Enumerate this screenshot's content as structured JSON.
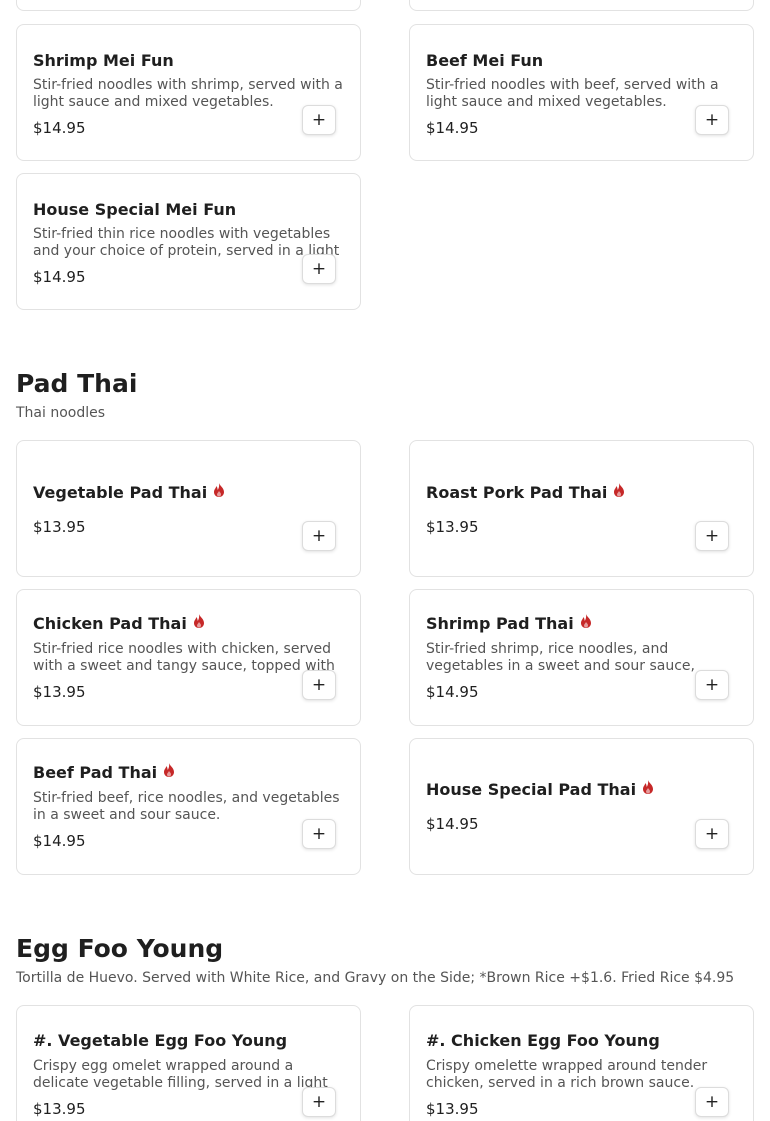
{
  "colors": {
    "flame": "#c62828",
    "border": "#e2e2e2",
    "desc": "#555555"
  },
  "mei_fun": {
    "items": [
      {
        "name": "Shrimp Mei Fun",
        "desc": "Stir-fried noodles with shrimp, served with a light sauce and mixed vegetables.",
        "price": "$14.95",
        "add": "+"
      },
      {
        "name": "Beef Mei Fun",
        "desc": "Stir-fried noodles with beef, served with a light sauce and mixed vegetables.",
        "price": "$14.95",
        "add": "+"
      },
      {
        "name": "House Special Mei Fun",
        "desc": "Stir-fried thin rice noodles with vegetables and your choice of protein, served in a light sauce.",
        "price": "$14.95",
        "add": "+"
      }
    ]
  },
  "pad_thai": {
    "title": "Pad Thai",
    "subtitle": "Thai noodles",
    "items": [
      {
        "name": "Vegetable Pad Thai",
        "icon": "spicy-flame-icon",
        "desc": "",
        "price": "$13.95",
        "add": "+"
      },
      {
        "name": "Roast Pork Pad Thai",
        "icon": "spicy-flame-icon",
        "desc": "",
        "price": "$13.95",
        "add": "+"
      },
      {
        "name": "Chicken Pad Thai",
        "icon": "spicy-flame-icon",
        "desc": "Stir-fried rice noodles with chicken, served with a sweet and tangy sauce, topped with peanuts.",
        "price": "$13.95",
        "add": "+"
      },
      {
        "name": "Shrimp Pad Thai",
        "icon": "spicy-flame-icon",
        "desc": "Stir-fried shrimp, rice noodles, and vegetables in a sweet and sour sauce,",
        "price": "$14.95",
        "add": "+"
      },
      {
        "name": "Beef Pad Thai",
        "icon": "spicy-flame-icon",
        "desc": "Stir-fried beef, rice noodles, and vegetables in a sweet and sour sauce.",
        "price": "$14.95",
        "add": "+"
      },
      {
        "name": "House Special Pad Thai",
        "icon": "spicy-flame-icon",
        "desc": "",
        "price": "$14.95",
        "add": "+"
      }
    ]
  },
  "egg_foo_young": {
    "title": "Egg Foo Young",
    "subtitle": "Tortilla de Huevo. Served with White Rice, and Gravy on the Side; *Brown Rice +$1.6. Fried Rice $4.95",
    "items": [
      {
        "name": "#. Vegetable Egg Foo Young",
        "desc": "Crispy egg omelet wrapped around a delicate vegetable filling, served in a light sauce.",
        "price": "$13.95",
        "add": "+"
      },
      {
        "name": "#. Chicken Egg Foo Young",
        "desc": "Crispy omelette wrapped around tender chicken, served in a rich brown sauce.",
        "price": "$13.95",
        "add": "+"
      }
    ]
  }
}
